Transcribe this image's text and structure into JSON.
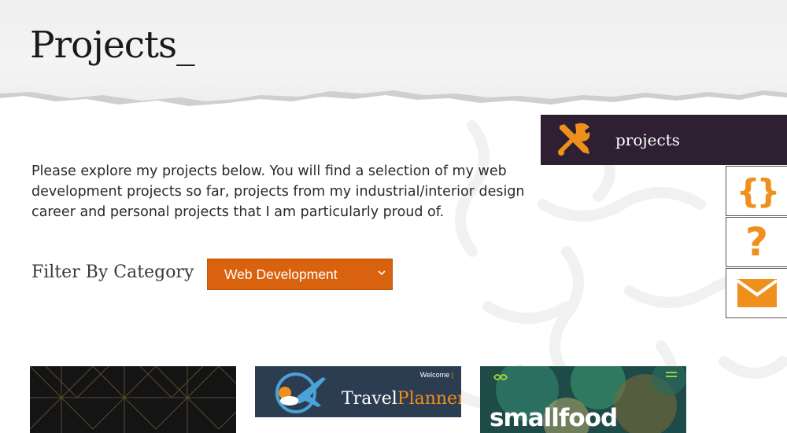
{
  "header": {
    "title": "Projects_"
  },
  "intro": {
    "text": "Please explore my projects below. You will find a selection of my web development projects so far, projects from my industrial/interior design career and personal projects that I am particularly proud of."
  },
  "filter": {
    "label": "Filter By Category",
    "selected": "Web Development"
  },
  "side_nav": {
    "projects_label": "projects",
    "items": [
      {
        "icon": "tools-icon",
        "label": "projects"
      },
      {
        "icon": "curly-braces-icon"
      },
      {
        "icon": "question-mark-icon"
      },
      {
        "icon": "envelope-icon"
      }
    ]
  },
  "cards": [
    {
      "name": "pattern-project"
    },
    {
      "name": "travel-planner",
      "welcome": "Welcome",
      "brand_first": "Travel",
      "brand_second": "Planner"
    },
    {
      "name": "smallfood",
      "word": "smallfood"
    }
  ],
  "colors": {
    "accent": "#d9620e",
    "icon_orange": "#f0901c",
    "nav_dark": "#2e1f33",
    "text": "#2a2a2a"
  }
}
